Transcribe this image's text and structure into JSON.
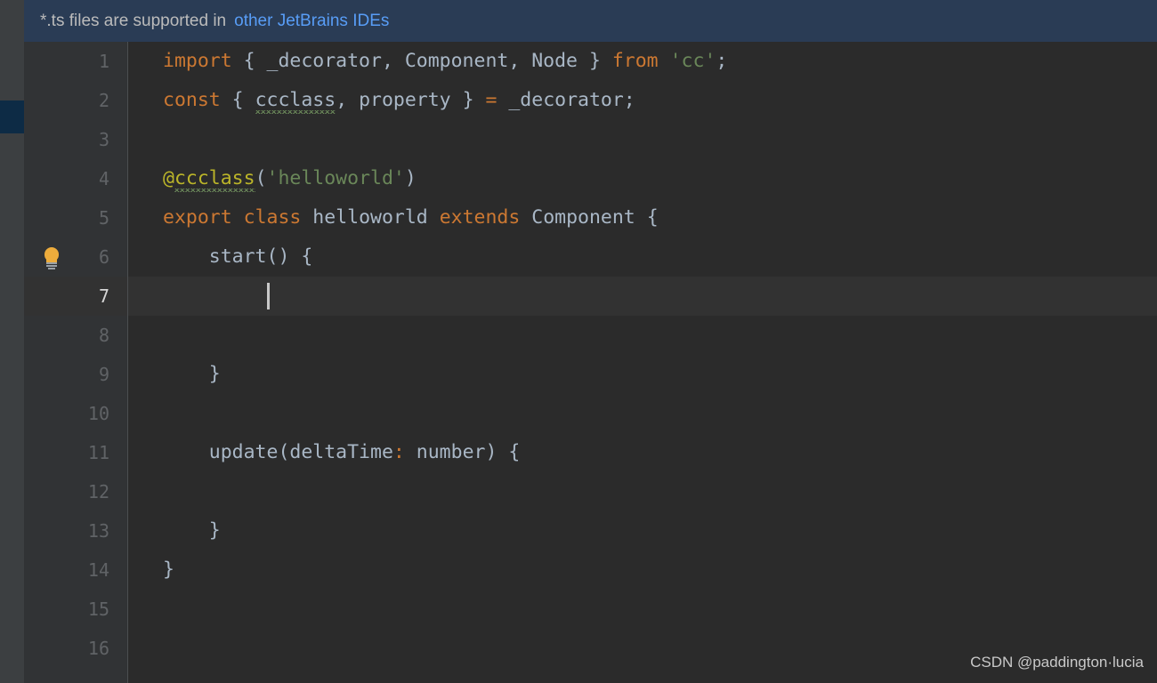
{
  "app": {
    "theme": "darcula",
    "colors": {
      "editor_bg": "#2b2b2b",
      "gutter_bg": "#313335",
      "stripe_bg": "#3c3f41",
      "stripe_marker": "#0d2b45",
      "notification_bg": "#2a3c55",
      "link": "#589df6",
      "keyword": "#cc7832",
      "string": "#6a8759",
      "annotation": "#bbb529",
      "default_text": "#a9b7c6",
      "line_number": "#606366",
      "current_line_bg": "#323232",
      "caret": "#c8c8c8",
      "squiggle_warning": "#6a8759",
      "bulb": "#edac3c"
    }
  },
  "notification": {
    "message": "*.ts files are supported in",
    "link_label": "other JetBrains IDEs"
  },
  "editor": {
    "caret_line": 7,
    "caret_column": 9,
    "bulb_line": 6,
    "lines": [
      {
        "number": "1",
        "tokens": [
          {
            "text": "import",
            "kind": "keyword"
          },
          {
            "text": " { _decorator, Component, Node } ",
            "kind": "default"
          },
          {
            "text": "from",
            "kind": "keyword"
          },
          {
            "text": " ",
            "kind": "default"
          },
          {
            "text": "'cc'",
            "kind": "string"
          },
          {
            "text": ";",
            "kind": "default"
          }
        ]
      },
      {
        "number": "2",
        "tokens": [
          {
            "text": "const",
            "kind": "keyword"
          },
          {
            "text": " { ",
            "kind": "default"
          },
          {
            "text": "ccclass",
            "kind": "default",
            "squiggle": true
          },
          {
            "text": ", property } ",
            "kind": "default"
          },
          {
            "text": "=",
            "kind": "operator"
          },
          {
            "text": " _decorator;",
            "kind": "default"
          }
        ]
      },
      {
        "number": "3",
        "tokens": []
      },
      {
        "number": "4",
        "tokens": [
          {
            "text": "@",
            "kind": "annotation"
          },
          {
            "text": "ccclass",
            "kind": "annotation",
            "squiggle": true
          },
          {
            "text": "(",
            "kind": "default"
          },
          {
            "text": "'helloworld'",
            "kind": "string"
          },
          {
            "text": ")",
            "kind": "default"
          }
        ]
      },
      {
        "number": "5",
        "tokens": [
          {
            "text": "export",
            "kind": "keyword"
          },
          {
            "text": " ",
            "kind": "default"
          },
          {
            "text": "class",
            "kind": "keyword"
          },
          {
            "text": " helloworld ",
            "kind": "default"
          },
          {
            "text": "extends",
            "kind": "keyword"
          },
          {
            "text": " Component {",
            "kind": "default"
          }
        ]
      },
      {
        "number": "6",
        "tokens": [
          {
            "text": "    start() {",
            "kind": "default"
          }
        ]
      },
      {
        "number": "7",
        "tokens": [],
        "current": true
      },
      {
        "number": "8",
        "tokens": []
      },
      {
        "number": "9",
        "tokens": [
          {
            "text": "    }",
            "kind": "default"
          }
        ]
      },
      {
        "number": "10",
        "tokens": []
      },
      {
        "number": "11",
        "tokens": [
          {
            "text": "    update(deltaTime",
            "kind": "default"
          },
          {
            "text": ":",
            "kind": "operator"
          },
          {
            "text": " number) {",
            "kind": "default"
          }
        ]
      },
      {
        "number": "12",
        "tokens": []
      },
      {
        "number": "13",
        "tokens": [
          {
            "text": "    }",
            "kind": "default"
          }
        ]
      },
      {
        "number": "14",
        "tokens": [
          {
            "text": "}",
            "kind": "default"
          }
        ]
      },
      {
        "number": "15",
        "tokens": []
      },
      {
        "number": "16",
        "tokens": []
      }
    ]
  },
  "watermark": {
    "text": "CSDN @paddington·lucia"
  }
}
